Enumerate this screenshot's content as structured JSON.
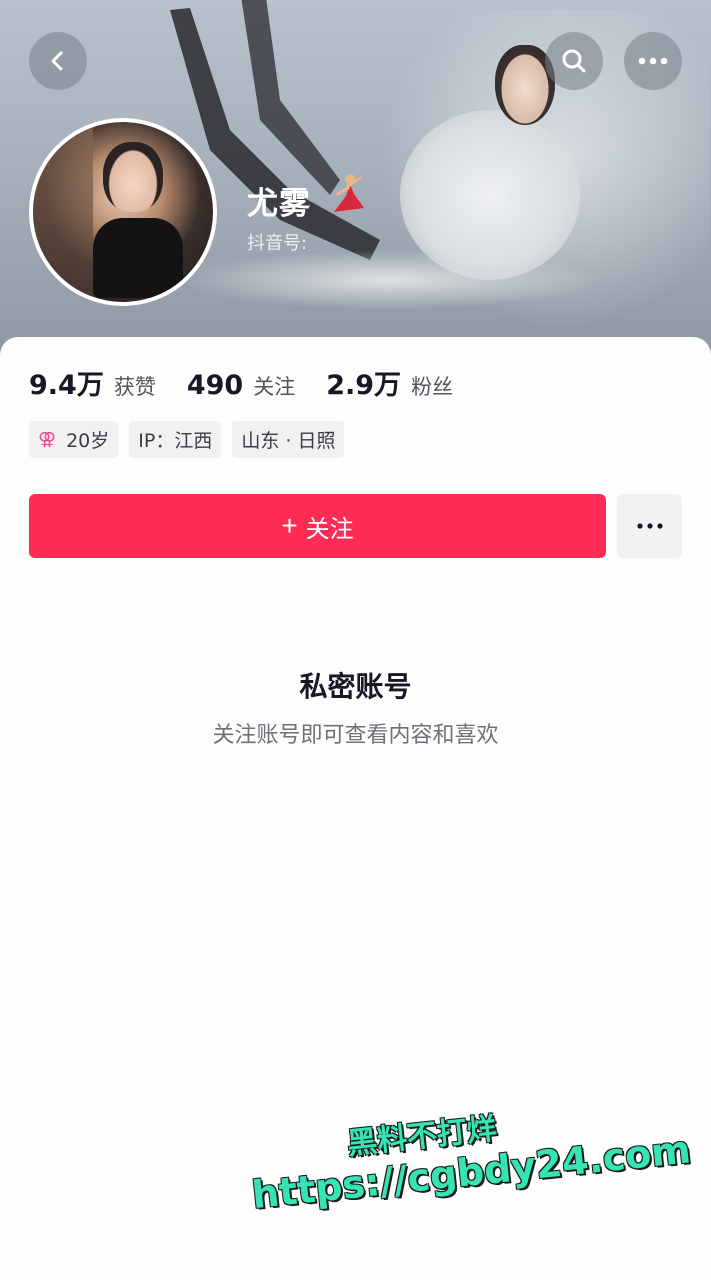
{
  "header": {
    "back_icon": "chevron-left-icon",
    "search_icon": "search-icon",
    "more_icon": "ellipsis-icon"
  },
  "profile": {
    "name": "尤雾",
    "name_emoji": "💃",
    "douyin_id_label": "抖音号:"
  },
  "stats": [
    {
      "value": "9.4万",
      "label": "获赞"
    },
    {
      "value": "490",
      "label": "关注"
    },
    {
      "value": "2.9万",
      "label": "粉丝"
    }
  ],
  "tags": {
    "age": {
      "icon": "female-icon",
      "text": "20岁"
    },
    "ip": "IP：江西",
    "location": "山东 · 日照"
  },
  "actions": {
    "follow_label": "关注",
    "follow_icon": "plus-icon",
    "more_icon": "ellipsis-icon"
  },
  "private": {
    "title": "私密账号",
    "subtitle": "关注账号即可查看内容和喜欢"
  },
  "watermark": {
    "line1": "黑料不打烊",
    "line2": "https://cgbdy24.com"
  },
  "colors": {
    "accent": "#fe2c55",
    "watermark": "#35e3b3",
    "gender": "#f04a9a"
  }
}
